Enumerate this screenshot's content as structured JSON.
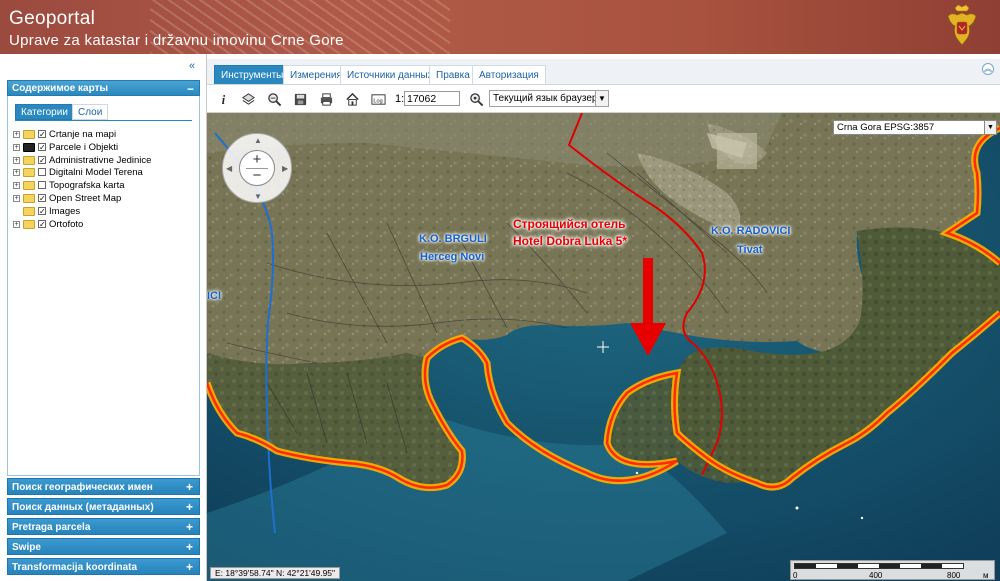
{
  "header": {
    "title": "Geoportal",
    "subtitle": "Uprave za katastar i državnu imovinu Crne Gore",
    "logo_icon": "montenegro-coat-of-arms-icon"
  },
  "left_panel": {
    "collapse_icon": "double-chevron-left-icon",
    "contents": {
      "title": "Содержимое карты",
      "toggle": "−",
      "tabs": [
        {
          "label": "Категории",
          "active": true
        },
        {
          "label": "Слои",
          "active": false
        }
      ],
      "tree": [
        {
          "label": "Crtanje na mapi",
          "checked": true
        },
        {
          "label": "Parcele i Objekti",
          "checked": true,
          "dark_icon": true
        },
        {
          "label": "Administrativne Jedinice",
          "checked": true
        },
        {
          "label": "Digitalni Model Terena",
          "checked": false
        },
        {
          "label": "Topografska karta",
          "checked": false
        },
        {
          "label": "Open Street Map",
          "checked": true
        },
        {
          "label": "Images",
          "checked": true,
          "no_expander": true
        },
        {
          "label": "Ortofoto",
          "checked": true
        }
      ]
    },
    "accordions": [
      {
        "label": "Поиск географических имен",
        "toggle": "+"
      },
      {
        "label": "Поиск данных (метаданных)",
        "toggle": "+"
      },
      {
        "label": "Pretraga parcela",
        "toggle": "+"
      },
      {
        "label": "Swipe",
        "toggle": "+"
      },
      {
        "label": "Transformacija koordinata",
        "toggle": "+"
      }
    ]
  },
  "main_tabs": [
    {
      "label": "Инструменты",
      "active": true
    },
    {
      "label": "Измерения",
      "active": false
    },
    {
      "label": "Источники данных",
      "active": false
    },
    {
      "label": "Правка",
      "active": false
    },
    {
      "label": "Авторизация",
      "active": false
    }
  ],
  "toolbar": {
    "tools": [
      "info-icon",
      "layers-icon",
      "zoom-extent-icon",
      "save-icon",
      "print-icon",
      "home-icon",
      "log-icon"
    ],
    "scale_prefix": "1:",
    "scale_value": "17062",
    "zoom_icon": "zoom-scale-icon",
    "language_value": "Текущий язык браузера"
  },
  "map": {
    "projection_value": "Crna Gora EPSG:3857",
    "labels": [
      {
        "text": "K.O. BRGULI"
      },
      {
        "text": "Herceg Novi"
      },
      {
        "text": "K.O. RADOVICI"
      },
      {
        "text": "Tivat"
      },
      {
        "text": "ICI"
      }
    ],
    "annotation": {
      "line1": "Строящийся отель",
      "line2": "Hotel Dobra Luka 5*"
    },
    "coordinates": "E: 18°39'58.74\"   N: 42°21'49.95\"",
    "scalebar": {
      "ticks": [
        "0",
        "400",
        "800"
      ],
      "unit": "м"
    },
    "colors": {
      "coast_outline": "#ff2a00",
      "coast_glow": "#ffb300",
      "boundary_line": "#e00000",
      "river_line": "#1e6fd0",
      "sea": "#154d6b",
      "land": "#7a7a58"
    }
  }
}
